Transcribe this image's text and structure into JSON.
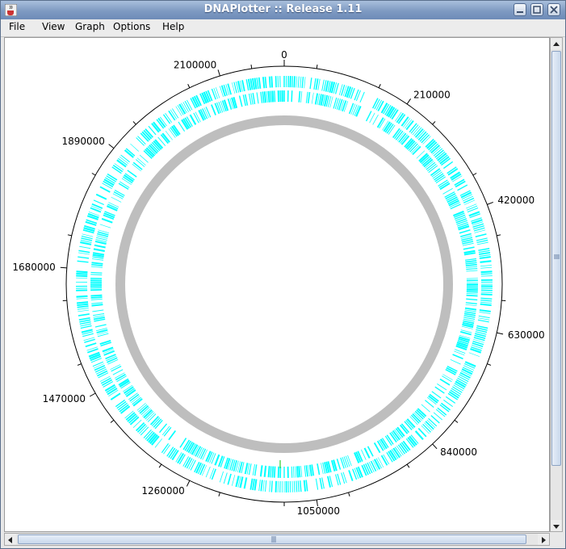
{
  "window": {
    "title": "DNAPlotter :: Release 1.11"
  },
  "menu": [
    "File",
    "View",
    "Graph",
    "Options",
    "Help"
  ],
  "plot": {
    "track_color": "#00ffff",
    "gc_ring_color": "#bebebe",
    "marker_color": "#00c000",
    "ticks": [
      {
        "value": "0",
        "label": "0"
      },
      {
        "value": "210000",
        "label": "210000"
      },
      {
        "value": "420000",
        "label": "420000"
      },
      {
        "value": "630000",
        "label": "630000"
      },
      {
        "value": "840000",
        "label": "840000"
      },
      {
        "value": "1050000",
        "label": "1050000"
      },
      {
        "value": "1260000",
        "label": "1260000"
      },
      {
        "value": "1470000",
        "label": "1470000"
      },
      {
        "value": "1680000",
        "label": "1680000"
      },
      {
        "value": "1890000",
        "label": "1890000"
      },
      {
        "value": "2100000",
        "label": "2100000"
      }
    ]
  },
  "icons": {
    "app": "java-cup-icon",
    "minimize": "minimize-icon",
    "maximize": "maximize-icon",
    "close": "close-icon"
  }
}
